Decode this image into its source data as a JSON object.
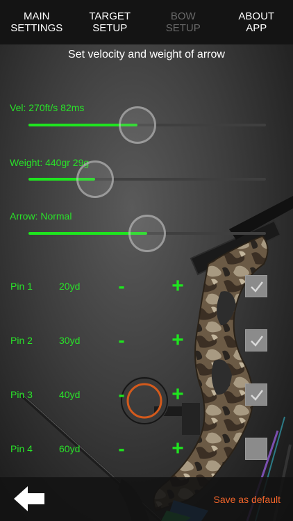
{
  "nav": {
    "items": [
      {
        "label": "MAIN\nSETTINGS",
        "enabled": true
      },
      {
        "label": "TARGET\nSETUP",
        "enabled": true
      },
      {
        "label": "BOW\nSETUP",
        "enabled": false
      },
      {
        "label": "ABOUT\nAPP",
        "enabled": true
      }
    ]
  },
  "subtitle": "Set velocity and weight of arrow",
  "sliders": [
    {
      "label": "Vel: 270ft/s 82ms",
      "level": 0.46
    },
    {
      "label": "Weight: 440gr 29g",
      "level": 0.28
    },
    {
      "label": "Arrow: Normal",
      "level": 0.5
    }
  ],
  "pins": [
    {
      "label": "Pin 1",
      "distance": "20yd",
      "minus": "-",
      "plus": "+",
      "checked": true
    },
    {
      "label": "Pin 2",
      "distance": "30yd",
      "minus": "-",
      "plus": "+",
      "checked": true
    },
    {
      "label": "Pin 3",
      "distance": "40yd",
      "minus": "-",
      "plus": "+",
      "checked": true
    },
    {
      "label": "Pin 4",
      "distance": "60yd",
      "minus": "-",
      "plus": "+",
      "checked": false
    }
  ],
  "footer": {
    "save_label": "Save as default"
  },
  "colors": {
    "accent_green": "#1fe51f",
    "save_orange": "#f0642a",
    "nav_disabled": "#6a6a6a"
  }
}
